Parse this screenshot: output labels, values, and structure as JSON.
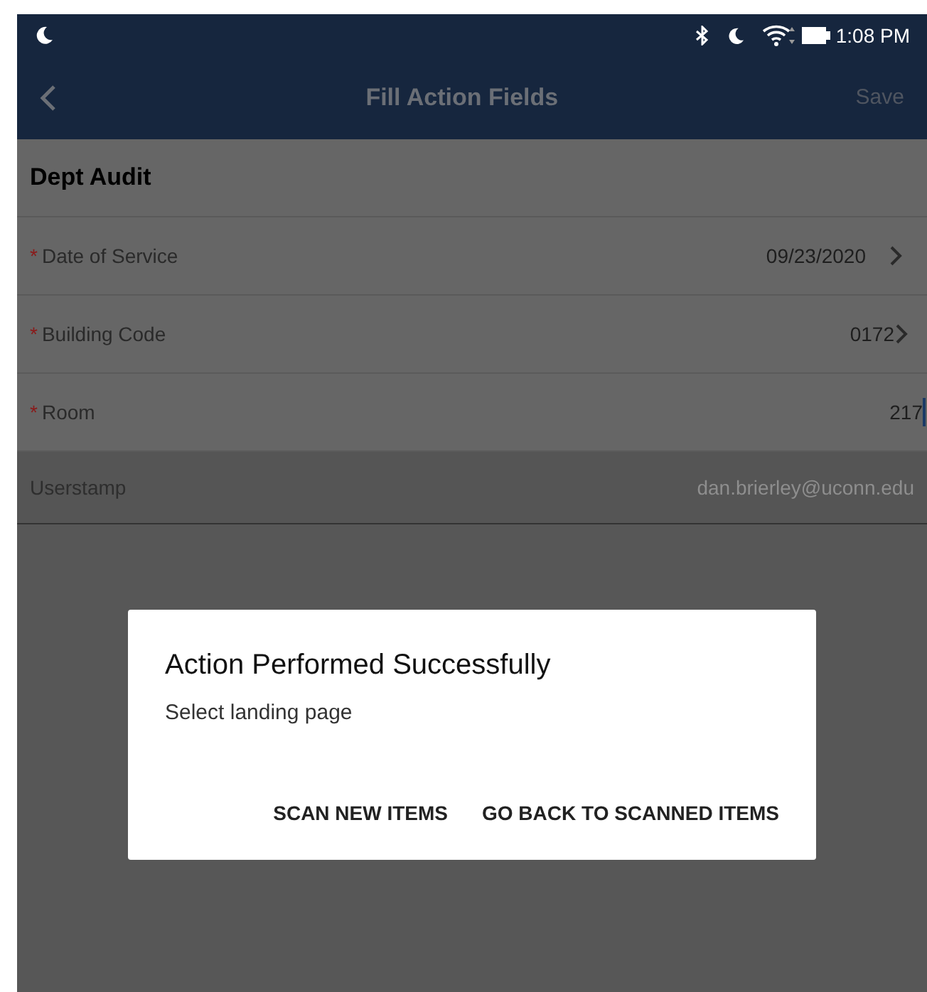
{
  "status_bar": {
    "time": "1:08 PM"
  },
  "header": {
    "title": "Fill Action Fields",
    "save_label": "Save",
    "save_disabled": true
  },
  "section": {
    "title": "Dept Audit"
  },
  "fields": [
    {
      "label": "Date of Service",
      "value": "09/23/2020",
      "required": true,
      "kind": "picker"
    },
    {
      "label": "Building Code",
      "value": "0172",
      "required": true,
      "kind": "picker-tight"
    },
    {
      "label": "Room",
      "value": "217",
      "required": true,
      "kind": "input"
    },
    {
      "label": "Userstamp",
      "value": "dan.brierley@uconn.edu",
      "required": false,
      "kind": "readonly"
    }
  ],
  "required_mark": "*",
  "dialog": {
    "title": "Action Performed Successfully",
    "message": "Select landing page",
    "buttons": [
      "SCAN NEW ITEMS",
      "GO BACK TO SCANNED ITEMS"
    ]
  }
}
